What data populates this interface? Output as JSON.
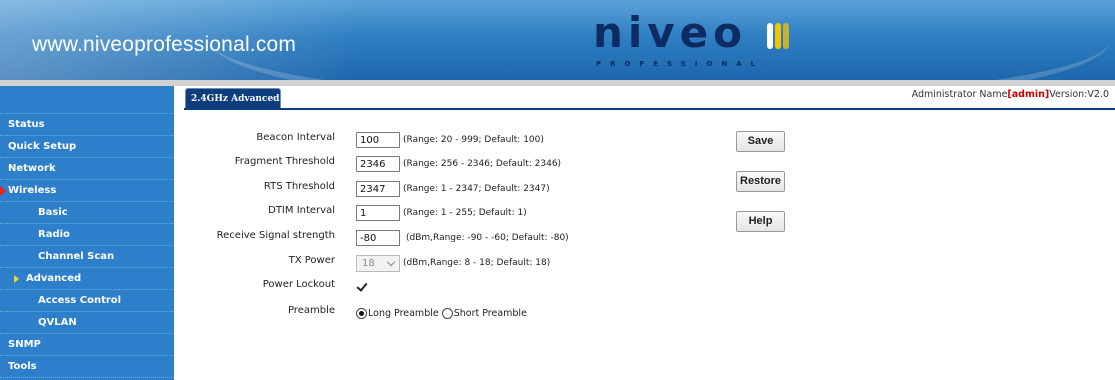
{
  "header": {
    "site_url": "www.niveoprofessional.com",
    "logo_text": "niveo",
    "logo_sub": "PROFESSIONAL",
    "colors": {
      "header_blue": "#2f7fc2",
      "logo_navy": "#0e2c63",
      "logo_yellow": "#f5c400"
    }
  },
  "sidebar": {
    "items": [
      {
        "label": "Status"
      },
      {
        "label": "Quick Setup"
      },
      {
        "label": "Network"
      },
      {
        "label": "Wireless",
        "expanded": true
      },
      {
        "label": "Basic"
      },
      {
        "label": "Radio"
      },
      {
        "label": "Channel Scan"
      },
      {
        "label": "Advanced",
        "selected": true
      },
      {
        "label": "Access Control"
      },
      {
        "label": "QVLAN"
      },
      {
        "label": "SNMP"
      },
      {
        "label": "Tools"
      }
    ]
  },
  "tab": {
    "label": "2.4GHz Advanced"
  },
  "admin": {
    "prefix": "Administrator Name",
    "bracket_open": "[",
    "user": "admin",
    "bracket_close": "]",
    "version": "Version:V2.0"
  },
  "form": {
    "beacon": {
      "label": "Beacon Interval",
      "value": "100",
      "hint": "(Range: 20 - 999; Default: 100)"
    },
    "fragment": {
      "label": "Fragment Threshold",
      "value": "2346",
      "hint": "(Range: 256 - 2346; Default: 2346)"
    },
    "rts": {
      "label": "RTS Threshold",
      "value": "2347",
      "hint": "(Range: 1 - 2347; Default: 2347)"
    },
    "dtim": {
      "label": "DTIM Interval",
      "value": "1",
      "hint": "(Range: 1 - 255; Default: 1)"
    },
    "rssi": {
      "label": "Receive Signal strength",
      "value": "-80",
      "hint": "(dBm,Range: -90 - -60; Default: -80)"
    },
    "tx_power": {
      "label": "TX Power",
      "value": "18",
      "hint": "(dBm,Range: 8 - 18; Default: 18)"
    },
    "power_lockout": {
      "label": "Power Lockout",
      "checked": true
    },
    "preamble": {
      "label": "Preamble",
      "option_long": "Long Preamble",
      "option_short": "Short Preamble",
      "selected": "Long Preamble"
    }
  },
  "buttons": {
    "save": "Save",
    "restore": "Restore",
    "help": "Help"
  }
}
